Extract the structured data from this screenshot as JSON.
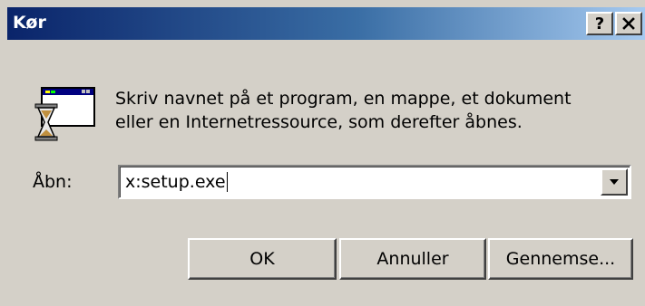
{
  "window": {
    "title": "Kør",
    "help_label": "?",
    "close_icon": "close-icon"
  },
  "description": {
    "line1": "Skriv navnet på et program, en mappe, et dokument",
    "line2": "eller en Internetressource, som derefter åbnes."
  },
  "open_field": {
    "label": "Åbn:",
    "value": "x:setup.exe"
  },
  "buttons": {
    "ok": "OK",
    "cancel": "Annuller",
    "browse": "Gennemse..."
  },
  "colors": {
    "titlebar_start": "#0a246a",
    "titlebar_end": "#a6caf0",
    "face": "#d4d0c8"
  }
}
